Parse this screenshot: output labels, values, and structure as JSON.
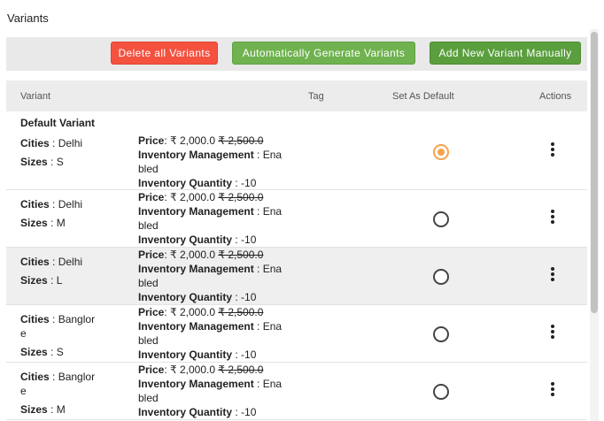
{
  "section_title": "Variants",
  "toolbar": {
    "delete_all_label": "Delete all Variants",
    "auto_generate_label": "Automatically Generate Variants",
    "add_manual_label": "Add New Variant Manually"
  },
  "table": {
    "headers": {
      "variant": "Variant",
      "tag": "Tag",
      "set_default": "Set As Default",
      "actions": "Actions"
    },
    "default_variant_label": "Default Variant",
    "labels": {
      "cities": "Cities",
      "sizes": "Sizes",
      "price": "Price",
      "inventory_mgmt_line1": "Inventory Management",
      "inventory_qty": "Inventory Quantity"
    },
    "rows": [
      {
        "city_line1": ": Delhi",
        "city_line2": "",
        "size": ": S",
        "price": ": ₹ 2,000.0",
        "price_old": "₹ 2,500.0",
        "inv_mgmt_a": ": Ena",
        "inv_mgmt_b": "bled",
        "inv_qty": ": -10",
        "is_default": true
      },
      {
        "city_line1": ": Delhi",
        "city_line2": "",
        "size": ": M",
        "price": ": ₹ 2,000.0",
        "price_old": "₹ 2,500.0",
        "inv_mgmt_a": ": Ena",
        "inv_mgmt_b": "bled",
        "inv_qty": ": -10",
        "is_default": false
      },
      {
        "city_line1": ": Delhi",
        "city_line2": "",
        "size": ": L",
        "price": ": ₹ 2,000.0",
        "price_old": "₹ 2,500.0",
        "inv_mgmt_a": ": Ena",
        "inv_mgmt_b": "bled",
        "inv_qty": ": -10",
        "is_default": false
      },
      {
        "city_line1": ": Banglor",
        "city_line2": "e",
        "size": ": S",
        "price": ": ₹ 2,000.0",
        "price_old": "₹ 2,500.0",
        "inv_mgmt_a": ": Ena",
        "inv_mgmt_b": "bled",
        "inv_qty": ": -10",
        "is_default": false
      },
      {
        "city_line1": ": Banglor",
        "city_line2": "e",
        "size": ": M",
        "price": ": ₹ 2,000.0",
        "price_old": "₹ 2,500.0",
        "inv_mgmt_a": ": Ena",
        "inv_mgmt_b": "bled",
        "inv_qty": ": -10",
        "is_default": false
      }
    ]
  },
  "colors": {
    "delete_button": "#f4513f",
    "generate_button": "#6fb24f",
    "add_button": "#5a9e3e",
    "radio_selected": "#f7a24a"
  },
  "icons": {
    "row_actions": "kebab-menu-icon"
  }
}
